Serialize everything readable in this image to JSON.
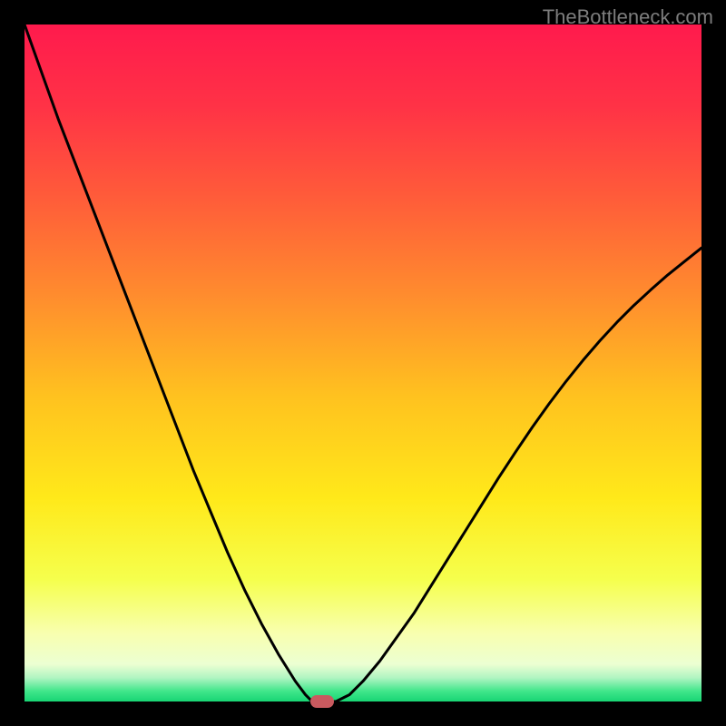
{
  "watermark": "TheBottleneck.com",
  "chart_data": {
    "type": "line",
    "title": "",
    "xlabel": "",
    "ylabel": "",
    "xlim": [
      0,
      100
    ],
    "ylim": [
      0,
      100
    ],
    "grid": false,
    "legend": false,
    "background_gradient": {
      "stops": [
        {
          "pos": 0.0,
          "color": "#ff1a4d"
        },
        {
          "pos": 0.12,
          "color": "#ff3246"
        },
        {
          "pos": 0.25,
          "color": "#ff5a3a"
        },
        {
          "pos": 0.4,
          "color": "#ff8c2e"
        },
        {
          "pos": 0.55,
          "color": "#ffc21f"
        },
        {
          "pos": 0.7,
          "color": "#ffe91a"
        },
        {
          "pos": 0.82,
          "color": "#f5ff4d"
        },
        {
          "pos": 0.9,
          "color": "#f8ffb0"
        },
        {
          "pos": 0.945,
          "color": "#ecffd2"
        },
        {
          "pos": 0.965,
          "color": "#b0f5c2"
        },
        {
          "pos": 0.985,
          "color": "#3fe68a"
        },
        {
          "pos": 1.0,
          "color": "#18d574"
        }
      ]
    },
    "series": [
      {
        "name": "bottleneck-curve",
        "color": "#000000",
        "x": [
          0.0,
          2.5,
          5.0,
          7.5,
          10.0,
          12.5,
          15.0,
          17.5,
          20.0,
          22.5,
          25.0,
          27.5,
          30.0,
          32.5,
          35.0,
          37.5,
          40.0,
          41.5,
          42.5,
          44.0,
          46.0,
          48.0,
          50.0,
          52.5,
          55.0,
          57.5,
          60.0,
          62.5,
          65.0,
          67.5,
          70.0,
          72.5,
          75.0,
          77.5,
          80.0,
          82.5,
          85.0,
          87.5,
          90.0,
          92.5,
          95.0,
          97.5,
          100.0
        ],
        "y": [
          100.0,
          93.0,
          86.0,
          79.5,
          73.0,
          66.5,
          60.0,
          53.5,
          47.0,
          40.5,
          34.0,
          28.0,
          22.0,
          16.5,
          11.5,
          7.0,
          3.0,
          1.0,
          0.0,
          0.0,
          0.0,
          1.0,
          3.0,
          6.0,
          9.5,
          13.0,
          17.0,
          21.0,
          25.0,
          29.0,
          33.0,
          36.8,
          40.5,
          44.0,
          47.3,
          50.4,
          53.3,
          56.0,
          58.5,
          60.8,
          63.0,
          65.0,
          67.0
        ]
      }
    ],
    "marker": {
      "x": 44.0,
      "y": 0.0,
      "color": "#c95a5f"
    }
  }
}
